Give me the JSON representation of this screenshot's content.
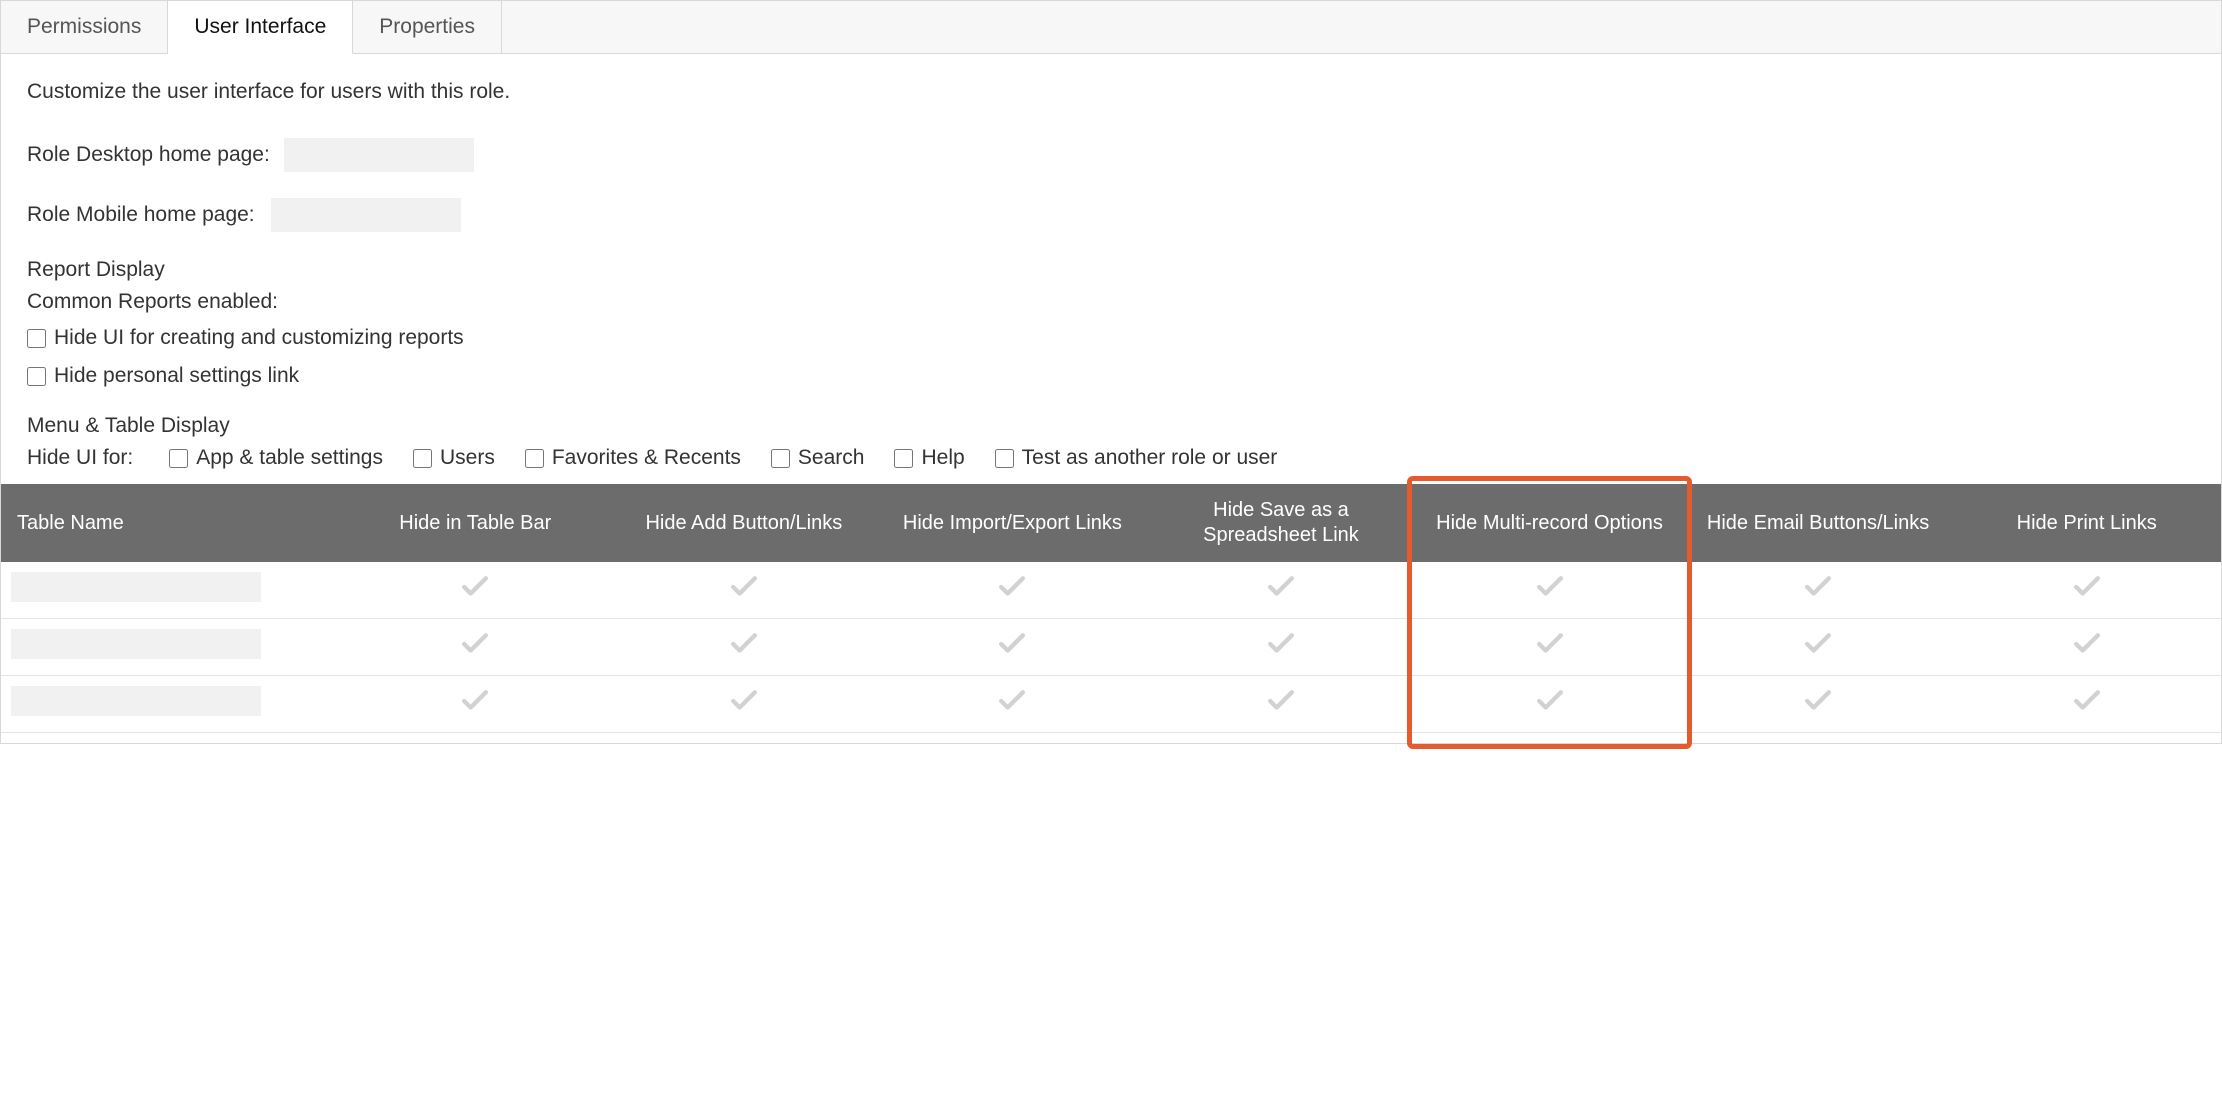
{
  "tabs": {
    "permissions": "Permissions",
    "user_interface": "User Interface",
    "properties": "Properties"
  },
  "description": "Customize the user interface for users with this role.",
  "fields": {
    "desktop_label": "Role Desktop home page:",
    "desktop_value": "",
    "mobile_label": "Role Mobile home page:",
    "mobile_value": ""
  },
  "report_display": {
    "heading": "Report Display",
    "common_reports": "Common Reports enabled:",
    "hide_reports": "Hide UI for creating and customizing reports",
    "hide_personal": "Hide personal settings link"
  },
  "menu_table": {
    "heading": "Menu & Table Display",
    "hide_ui_for": "Hide UI for:",
    "options": {
      "app_table": "App & table settings",
      "users": "Users",
      "favorites": "Favorites & Recents",
      "search": "Search",
      "help": "Help",
      "test_role": "Test as another role or user"
    }
  },
  "table": {
    "headers": {
      "name": "Table Name",
      "hide_bar": "Hide in Table Bar",
      "hide_add": "Hide Add Button/Links",
      "hide_import": "Hide Import/Export Links",
      "hide_save": "Hide Save as a Spreadsheet Link",
      "hide_multi": "Hide Multi-record Options",
      "hide_email": "Hide Email Buttons/Links",
      "hide_print": "Hide Print Links"
    },
    "rows": [
      {
        "name": ""
      },
      {
        "name": ""
      },
      {
        "name": ""
      }
    ]
  },
  "highlight_column": "hide_multi"
}
